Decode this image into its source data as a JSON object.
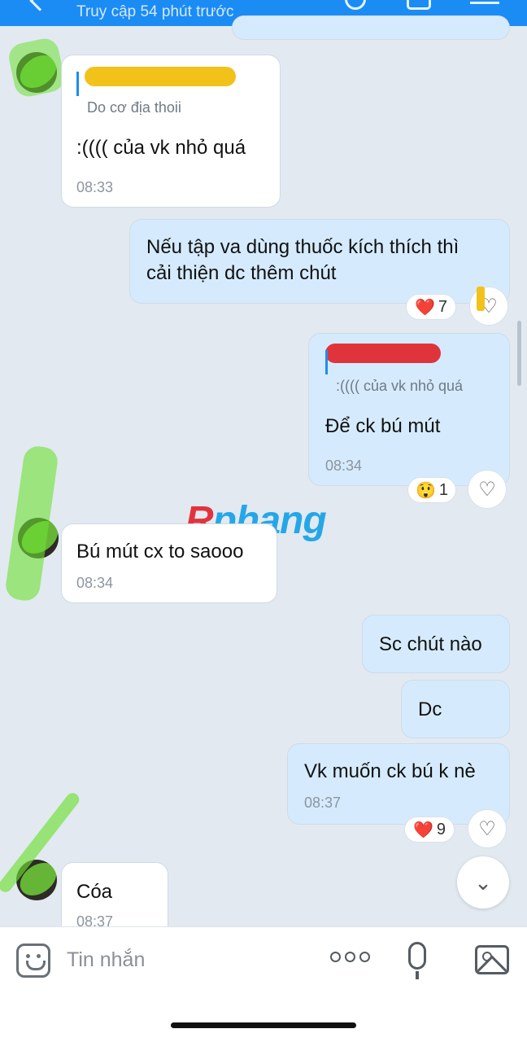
{
  "header": {
    "status": "Truy cập 54 phút trước",
    "back_icon": "chevron-left-icon",
    "call_icon": "phone-icon",
    "video_icon": "video-call-icon",
    "menu_icon": "menu-icon"
  },
  "messages": [
    {
      "direction": "in",
      "quote": "Do cơ địa thoii",
      "text": ":(((( của vk nhỏ quá",
      "time": "08:33"
    },
    {
      "direction": "out",
      "text_line1": "Nếu tập va dùng thuốc kích thích thì",
      "text_line2": "cải thiện dc thêm chút",
      "reaction": {
        "emoji": "❤️",
        "count": "7"
      }
    },
    {
      "direction": "out",
      "quote": ":(((( của vk nhỏ quá",
      "text": "Để ck bú mút",
      "time": "08:34",
      "reaction": {
        "emoji": "😲",
        "count": "1"
      }
    },
    {
      "direction": "in",
      "text": "Bú mút cx to saooo",
      "time": "08:34"
    },
    {
      "direction": "out",
      "text": "Sc chút nào"
    },
    {
      "direction": "out",
      "text": "Dc"
    },
    {
      "direction": "out",
      "text": "Vk muốn ck bú k nè",
      "time": "08:37",
      "reaction": {
        "emoji": "❤️",
        "count": "9"
      }
    },
    {
      "direction": "in",
      "text": "Cóa",
      "time": "08:37"
    }
  ],
  "watermark": {
    "r": "R",
    "rest": "phang"
  },
  "composer": {
    "placeholder": "Tin nhắn",
    "emoji_icon": "emoji-icon",
    "more_icon": "more-options-icon",
    "mic_icon": "microphone-icon",
    "image_icon": "image-icon"
  },
  "colors": {
    "header": "#1a8cf4",
    "background": "#e2e9f1",
    "bubble_out": "#d5ebfd",
    "bubble_in": "#ffffff",
    "quote_bar": "#1f8cf0"
  }
}
